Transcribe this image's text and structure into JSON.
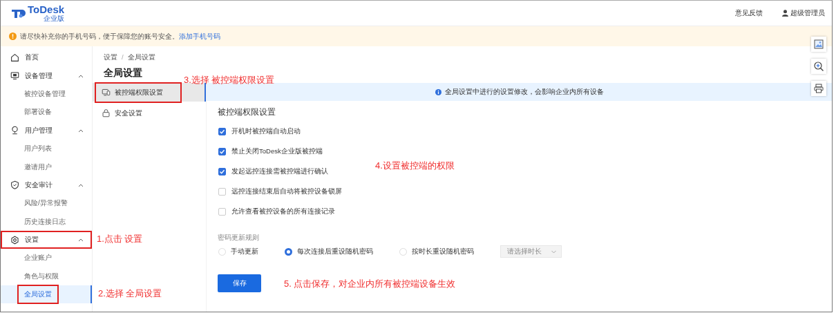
{
  "header": {
    "logo": "ToDesk",
    "logo_sub": "企业版",
    "feedback": "意见反馈",
    "user": "超级管理员"
  },
  "banner": {
    "text": "请尽快补充你的手机号码，便于保障您的账号安全。",
    "link": "添加手机号码"
  },
  "sidebar": {
    "items": [
      {
        "label": "首页",
        "kind": "link",
        "highlighted": false
      },
      {
        "label": "设备管理",
        "kind": "group",
        "expanded": true,
        "highlighted": false,
        "children": [
          {
            "label": "被控设备管理",
            "selected": false,
            "highlighted": false
          },
          {
            "label": "部署设备",
            "selected": false,
            "highlighted": false
          }
        ]
      },
      {
        "label": "用户管理",
        "kind": "group",
        "expanded": true,
        "highlighted": false,
        "children": [
          {
            "label": "用户列表",
            "selected": false,
            "highlighted": false
          },
          {
            "label": "邀请用户",
            "selected": false,
            "highlighted": false
          }
        ]
      },
      {
        "label": "安全审计",
        "kind": "group",
        "expanded": true,
        "highlighted": false,
        "children": [
          {
            "label": "风险/异常报警",
            "selected": false,
            "highlighted": false
          },
          {
            "label": "历史连接日志",
            "selected": false,
            "highlighted": false
          }
        ]
      },
      {
        "label": "设置",
        "kind": "group",
        "expanded": true,
        "highlighted": true,
        "children": [
          {
            "label": "企业账户",
            "selected": false,
            "highlighted": false
          },
          {
            "label": "角色与权限",
            "selected": false,
            "highlighted": false
          },
          {
            "label": "全局设置",
            "selected": true,
            "highlighted": true
          }
        ]
      }
    ]
  },
  "breadcrumb": {
    "items": [
      "设置",
      "全局设置"
    ],
    "separator": "/"
  },
  "page_title": "全局设置",
  "subnav": [
    {
      "label": "被控端权限设置",
      "selected": true,
      "highlighted": true
    },
    {
      "label": "安全设置",
      "selected": false,
      "highlighted": false
    }
  ],
  "notice": "全局设置中进行的设置修改，会影响企业内所有设备",
  "section_title": "被控端权限设置",
  "options": [
    {
      "label": "开机时被控端自动启动",
      "checked": true
    },
    {
      "label": "禁止关闭ToDesk企业版被控端",
      "checked": true
    },
    {
      "label": "发起远控连接需被控端进行确认",
      "checked": true
    },
    {
      "label": "远控连接结束后自动将被控设备锁屏",
      "checked": false
    },
    {
      "label": "允许查看被控设备的所有连接记录",
      "checked": false
    }
  ],
  "password_rule": {
    "label": "密码更新规则",
    "options": [
      {
        "label": "手动更新",
        "selected": false
      },
      {
        "label": "每次连接后重设随机密码",
        "selected": true
      },
      {
        "label": "按时长重设随机密码",
        "selected": false
      }
    ],
    "select_placeholder": "请选择时长",
    "select_disabled": true
  },
  "save_button": "保存",
  "annotations": [
    "1.点击 设置",
    "2.选择 全局设置",
    "3.选择 被控端权限设置",
    "4.设置被控端的权限",
    "5. 点击保存，对企业内所有被控端设备生效"
  ]
}
